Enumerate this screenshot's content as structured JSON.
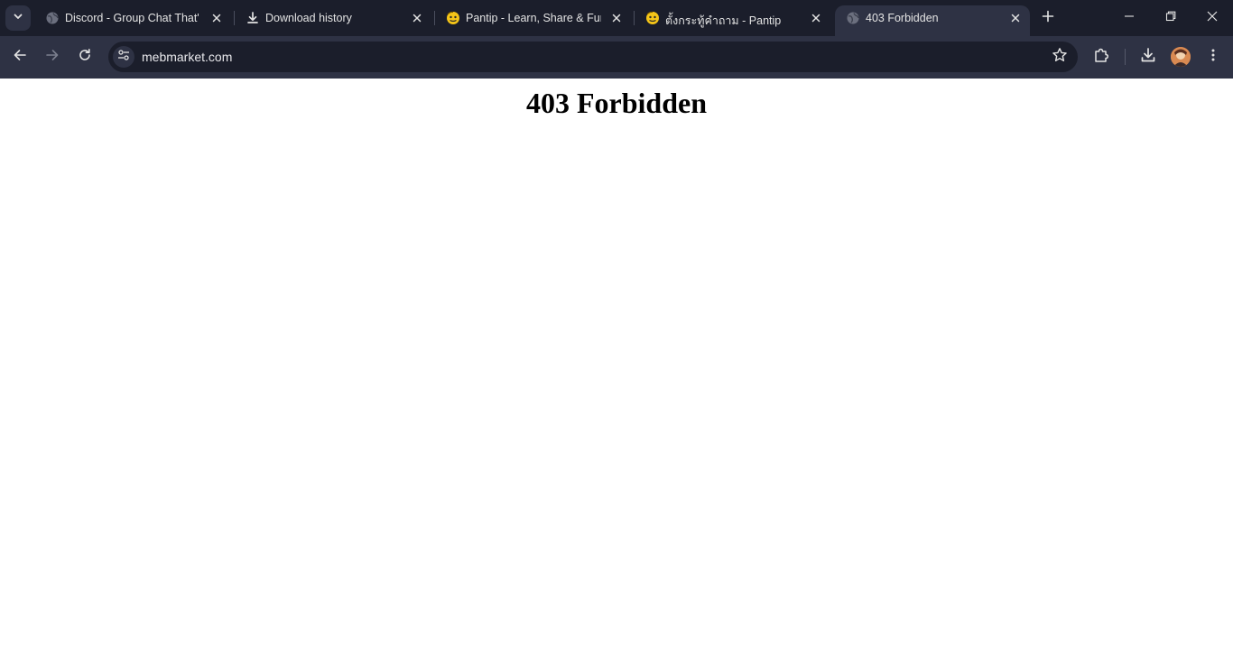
{
  "tab_search": {
    "icon": "chevron-down-icon"
  },
  "tabs": [
    {
      "title": "Discord - Group Chat That's",
      "icon": "globe-icon",
      "active": false
    },
    {
      "title": "Download history",
      "icon": "download-icon",
      "active": false
    },
    {
      "title": "Pantip - Learn, Share & Fun",
      "icon": "pantip-icon",
      "active": false
    },
    {
      "title": "ตั้งกระทู้คำถาม - Pantip",
      "icon": "pantip-icon",
      "active": false
    },
    {
      "title": "403 Forbidden",
      "icon": "globe-icon",
      "active": true
    }
  ],
  "new_tab": {
    "icon": "plus-icon"
  },
  "window_controls": {
    "minimize": "minimize-icon",
    "restore": "restore-icon",
    "close": "close-icon"
  },
  "toolbar": {
    "back": "back-arrow-icon",
    "forward": "forward-arrow-icon",
    "reload": "reload-icon",
    "url": "mebmarket.com",
    "bookmark": "star-icon",
    "extensions": "puzzle-icon",
    "downloads": "download-icon",
    "menu": "kebab-menu-icon"
  },
  "page": {
    "heading": "403 Forbidden"
  },
  "colors": {
    "tabstrip_bg": "#1b1e2b",
    "toolbar_bg": "#2e3244",
    "omnibox_bg": "#1b1e2b",
    "pantip_yellow": "#f5c518"
  }
}
